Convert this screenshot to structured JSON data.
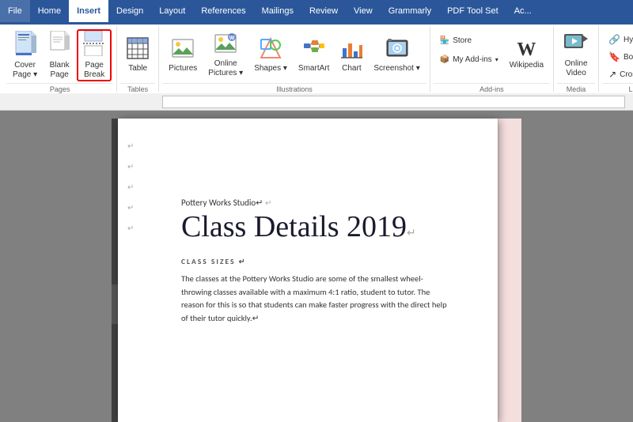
{
  "tabs": [
    {
      "label": "File",
      "active": false
    },
    {
      "label": "Home",
      "active": false
    },
    {
      "label": "Insert",
      "active": true
    },
    {
      "label": "Design",
      "active": false
    },
    {
      "label": "Layout",
      "active": false
    },
    {
      "label": "References",
      "active": false
    },
    {
      "label": "Mailings",
      "active": false
    },
    {
      "label": "Review",
      "active": false
    },
    {
      "label": "View",
      "active": false
    },
    {
      "label": "Grammarly",
      "active": false
    },
    {
      "label": "PDF Tool Set",
      "active": false
    },
    {
      "label": "Ac...",
      "active": false
    }
  ],
  "groups": {
    "pages": {
      "label": "Pages",
      "buttons": [
        {
          "id": "cover-page",
          "icon": "📄",
          "label": "Cover\nPage",
          "arrow": true
        },
        {
          "id": "blank-page",
          "icon": "📋",
          "label": "Blank\nPage"
        },
        {
          "id": "page-break",
          "icon": "⬚",
          "label": "Page\nBreak",
          "highlighted": true
        }
      ]
    },
    "tables": {
      "label": "Tables",
      "buttons": [
        {
          "id": "table",
          "icon": "⊞",
          "label": "Table",
          "arrow": true
        }
      ]
    },
    "illustrations": {
      "label": "Illustrations",
      "buttons": [
        {
          "id": "pictures",
          "icon": "🖼",
          "label": "Pictures"
        },
        {
          "id": "online-pictures",
          "icon": "🌐",
          "label": "Online\nPictures",
          "arrow": true
        },
        {
          "id": "shapes",
          "icon": "⬟",
          "label": "Shapes",
          "arrow": true
        },
        {
          "id": "smartart",
          "icon": "🔷",
          "label": "SmartArt"
        },
        {
          "id": "chart",
          "icon": "📊",
          "label": "Chart"
        },
        {
          "id": "screenshot",
          "icon": "📷",
          "label": "Screenshot",
          "arrow": true
        }
      ]
    },
    "addins": {
      "label": "Add-ins",
      "buttons": [
        {
          "id": "store",
          "icon": "🏪",
          "label": "Store"
        },
        {
          "id": "my-addins",
          "icon": "📦",
          "label": "My Add-ins",
          "arrow": true
        },
        {
          "id": "wikipedia",
          "icon": "W",
          "label": "Wikipedia"
        }
      ]
    },
    "media": {
      "label": "Media",
      "buttons": [
        {
          "id": "online-video",
          "icon": "▶",
          "label": "Online\nVideo"
        }
      ]
    },
    "links": {
      "label": "Links",
      "buttons": [
        {
          "id": "hyperlink",
          "icon": "🔗",
          "label": "Hyperlink"
        },
        {
          "id": "bookmark",
          "icon": "🔖",
          "label": "Bookmark"
        },
        {
          "id": "cross-ref",
          "icon": "↗",
          "label": "Cross-refer..."
        }
      ]
    }
  },
  "document": {
    "subtitle": "Pottery Works Studio↵",
    "title": "Class Details 2019↵",
    "section_label": "CLASS SIZES ↵",
    "body": "The classes at the Pottery Works Studio are some of the smallest wheel-throwing classes available with a maximum 4:1 ratio, student to tutor. The reason for this is so that students can make faster progress with the direct help of their tutor quickly.↵"
  }
}
